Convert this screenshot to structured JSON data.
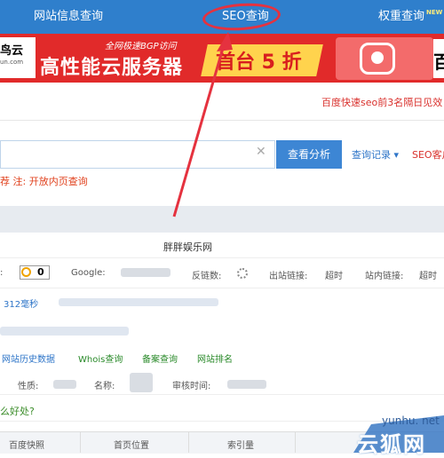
{
  "nav": {
    "site_info": "网站信息查询",
    "seo": "SEO查询",
    "weight": "权重查询",
    "new_badge": "NEW"
  },
  "ad": {
    "logo": "鸟云",
    "logo_sub": "un.com",
    "tag": "全网极速BGP访问",
    "headline": "高性能云服务器",
    "promo": "首台 5 折",
    "right_glyph": "百"
  },
  "notice": "百度快速seo前3名隔日见效",
  "search": {
    "value": "",
    "button": "查看分析",
    "history": "查询记录 ▾",
    "seo_customer": "SEO客户",
    "hint_prefix": "荐",
    "hint_note": "注:",
    "hint_link": "开放内页查询"
  },
  "site_name": "胖胖娱乐网",
  "metrics": {
    "pr_value": "0",
    "google_label": "Google:",
    "backlinks_label": "反链数:",
    "outlinks_label": "出站链接:",
    "outlinks_value": "超时",
    "inlinks_label": "站内链接:",
    "inlinks_value": "超时"
  },
  "response_time": "312毫秒",
  "links": {
    "history": "网站历史数据",
    "whois": "Whois查询",
    "icp": "备案查询",
    "rank": "网站排名"
  },
  "icp": {
    "nature": "性质:",
    "name": "名称:",
    "audit": "审核时间:"
  },
  "question": "么好处?",
  "table": {
    "col1": "百度快照",
    "col2": "首页位置",
    "col3": "索引量"
  },
  "watermark": {
    "url": "yunhu. net",
    "text": "云狐网"
  },
  "colors": {
    "nav_bg": "#2f7fcc",
    "ad_bg": "#e12a2a",
    "annotation": "#e5323f",
    "button": "#3d86d4"
  }
}
